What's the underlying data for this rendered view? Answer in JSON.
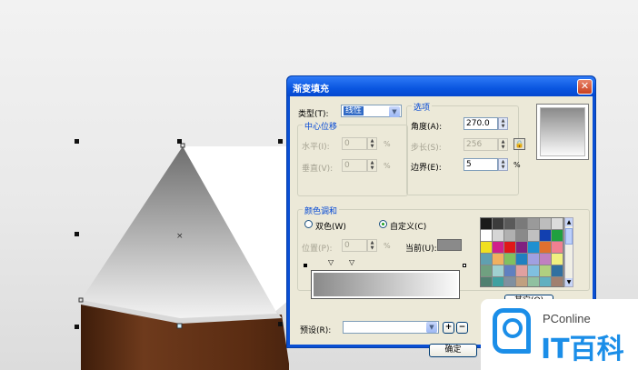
{
  "dialog": {
    "title": "渐变填充",
    "type_label": "类型(T):",
    "type_value": "线性",
    "center_offset": {
      "group": "中心位移",
      "horizontal_label": "水平(I):",
      "horizontal_value": "0",
      "vertical_label": "垂直(V):",
      "vertical_value": "0"
    },
    "options": {
      "group": "选项",
      "angle_label": "角度(A):",
      "angle_value": "270.0",
      "steps_label": "步长(S):",
      "steps_value": "256",
      "edge_label": "边界(E):",
      "edge_value": "5"
    },
    "blend": {
      "group": "颜色调和",
      "two_color_label": "双色(W)",
      "custom_label": "自定义(C)",
      "position_label": "位置(P):",
      "position_value": "0",
      "current_label": "当前(U):",
      "current_color": "#8a8a8a",
      "other_button": "其它(O)"
    },
    "preset_label": "预设(R):",
    "preset_value": "",
    "ok_button": "确定",
    "percent_sign": "%"
  },
  "watermark": {
    "brand": "PConline",
    "cn": "IT百科"
  },
  "palette": [
    "#1a1a1a",
    "#3c3c3c",
    "#5a5a5a",
    "#7a7a7a",
    "#9a9a9a",
    "#bdbdbd",
    "#dcdcdc",
    "#ffffff",
    "#d6d6d6",
    "#b0b0b0",
    "#8a8a8a",
    "#c0c0c0",
    "#1240b0",
    "#20a040",
    "#f0e020",
    "#d0208a",
    "#e01818",
    "#802080",
    "#1e90d0",
    "#e07030",
    "#f08090",
    "#60a0b0",
    "#f0b060",
    "#80c060",
    "#2080c0",
    "#a0a0e0",
    "#c080c0",
    "#f0f080",
    "#70a080",
    "#a0d0d0",
    "#6080c0",
    "#e0a0a0",
    "#80c0e0",
    "#b0d080",
    "#3070a0",
    "#508070",
    "#40a0a0",
    "#8090a0",
    "#c0a080",
    "#90c0a0",
    "#60b0c0",
    "#a08070",
    "#607080",
    "#304050",
    "#506050",
    "#7080a0",
    "#407060",
    "#80a080",
    "#90b0c0"
  ]
}
